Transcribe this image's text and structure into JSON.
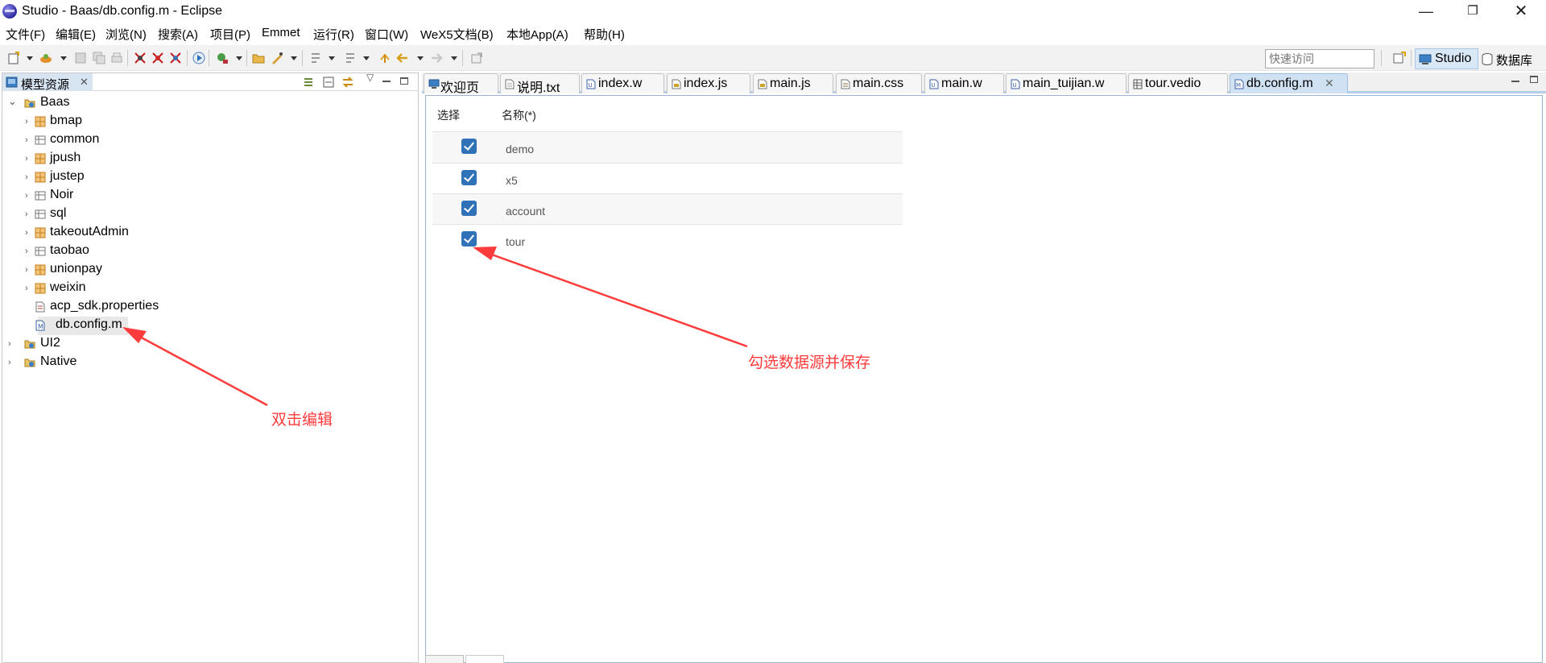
{
  "window": {
    "title": "Studio - Baas/db.config.m - Eclipse",
    "minimize": "—",
    "maximize": "❐",
    "close": "✕"
  },
  "menu": [
    "文件(F)",
    "编辑(E)",
    "浏览(N)",
    "搜索(A)",
    "项目(P)",
    "Emmet",
    "运行(R)",
    "窗口(W)",
    "WeX5文档(B)",
    "本地App(A)",
    "帮助(H)"
  ],
  "toolbar": {
    "quick_access": "快速访问",
    "perspective_studio": "Studio",
    "perspective_db": "数据库"
  },
  "left_panel": {
    "tab_label": "模型资源",
    "tab_close": "✕",
    "tree": [
      {
        "label": "Baas",
        "level": 0,
        "twisty": "⌄",
        "icon": "project-folder-icon"
      },
      {
        "label": "bmap",
        "level": 1,
        "twisty": "›",
        "icon": "package-icon"
      },
      {
        "label": "common",
        "level": 1,
        "twisty": "›",
        "icon": "model-folder-icon"
      },
      {
        "label": "jpush",
        "level": 1,
        "twisty": "›",
        "icon": "package-icon"
      },
      {
        "label": "justep",
        "level": 1,
        "twisty": "›",
        "icon": "package-icon"
      },
      {
        "label": "Noir",
        "level": 1,
        "twisty": "›",
        "icon": "model-folder-icon"
      },
      {
        "label": "sql",
        "level": 1,
        "twisty": "›",
        "icon": "model-folder-icon"
      },
      {
        "label": "takeoutAdmin",
        "level": 1,
        "twisty": "›",
        "icon": "package-icon"
      },
      {
        "label": "taobao",
        "level": 1,
        "twisty": "›",
        "icon": "model-folder-icon"
      },
      {
        "label": "unionpay",
        "level": 1,
        "twisty": "›",
        "icon": "package-icon"
      },
      {
        "label": "weixin",
        "level": 1,
        "twisty": "›",
        "icon": "package-icon"
      },
      {
        "label": "acp_sdk.properties",
        "level": 1,
        "twisty": "",
        "icon": "properties-file-icon"
      },
      {
        "label": "db.config.m",
        "level": 1,
        "twisty": "",
        "icon": "m-file-icon"
      },
      {
        "label": "UI2",
        "level": 0,
        "twisty": "›",
        "icon": "project-folder-icon"
      },
      {
        "label": "Native",
        "level": 0,
        "twisty": "›",
        "icon": "project-folder-icon"
      }
    ]
  },
  "editor": {
    "tabs": [
      {
        "label": "欢迎页",
        "icon": "welcome-icon"
      },
      {
        "label": "说明.txt",
        "icon": "text-file-icon"
      },
      {
        "label": "index.w",
        "icon": "w-file-icon"
      },
      {
        "label": "index.js",
        "icon": "js-file-icon"
      },
      {
        "label": "main.js",
        "icon": "js-file-icon"
      },
      {
        "label": "main.css",
        "icon": "css-file-icon"
      },
      {
        "label": "main.w",
        "icon": "w-file-icon"
      },
      {
        "label": "main_tuijian.w",
        "icon": "w-file-icon"
      },
      {
        "label": "tour.vedio",
        "icon": "table-icon"
      },
      {
        "label": "db.config.m",
        "icon": "m-file-icon",
        "active": true,
        "close": "✕"
      }
    ],
    "table": {
      "headers": [
        "选择",
        "名称(*)"
      ],
      "rows": [
        {
          "checked": true,
          "name": "demo"
        },
        {
          "checked": true,
          "name": "x5"
        },
        {
          "checked": true,
          "name": "account"
        },
        {
          "checked": true,
          "name": "tour"
        }
      ]
    }
  },
  "annotations": {
    "left": "双击编辑",
    "right": "勾选数据源并保存"
  },
  "colors": {
    "annotation": "#ff3b3b",
    "checkbox": "#2f72b8",
    "active_tab": "#cfe1f3"
  }
}
